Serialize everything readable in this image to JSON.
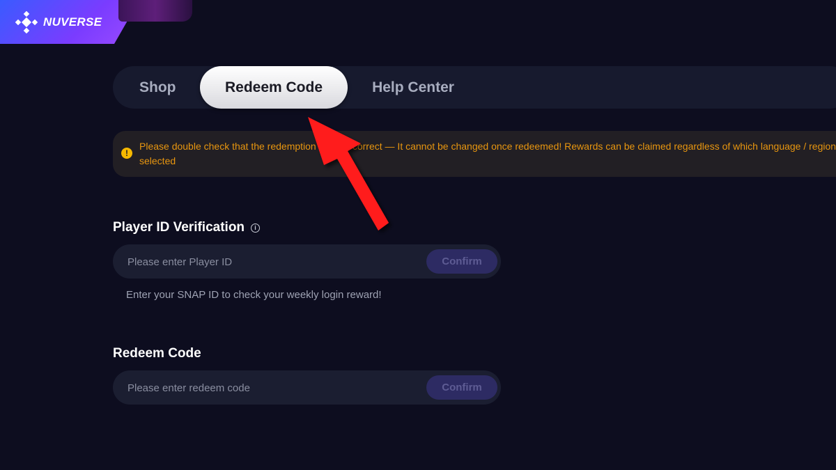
{
  "brand": {
    "name": "NUVERSE"
  },
  "tabs": [
    {
      "label": "Shop",
      "active": false
    },
    {
      "label": "Redeem Code",
      "active": true
    },
    {
      "label": "Help Center",
      "active": false
    }
  ],
  "notice": {
    "text": "Please double check that the redemption code is correct — It cannot be changed once redeemed! Rewards can be claimed regardless of which language / region is selected"
  },
  "player_section": {
    "title": "Player ID Verification",
    "placeholder": "Please enter Player ID",
    "confirm_label": "Confirm",
    "hint": "Enter your SNAP ID to check your weekly login reward!"
  },
  "redeem_section": {
    "title": "Redeem Code",
    "placeholder": "Please enter redeem code",
    "confirm_label": "Confirm"
  },
  "colors": {
    "background": "#0d0d1f",
    "notice_text": "#e8960f",
    "notice_icon": "#f6b800",
    "confirm_bg": "#2d2b63",
    "annotation_arrow": "#ff1a1a"
  }
}
